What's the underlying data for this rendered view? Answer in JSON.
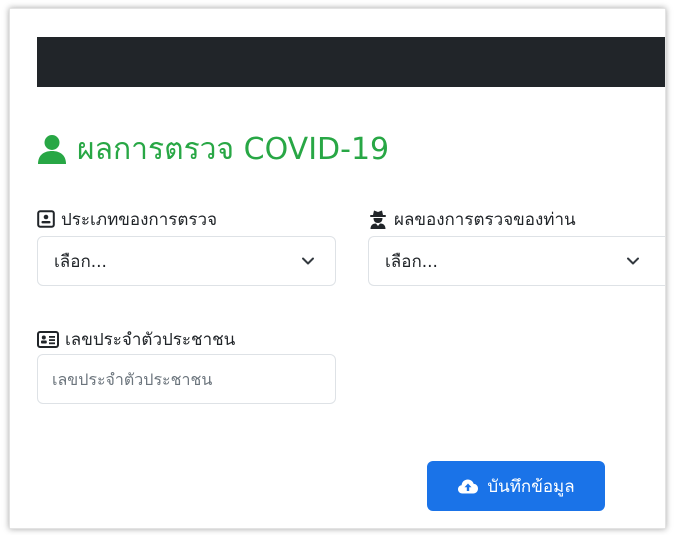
{
  "form": {
    "title": "ผลการตรวจ COVID-19",
    "test_type_label": "ประเภทของการตรวจ",
    "test_type_value": "เลือก...",
    "result_label": "ผลของการตรวจของท่าน",
    "result_value": "เลือก...",
    "id_label": "เลขประจำตัวประชาชน",
    "id_placeholder": "เลขประจำตัวประชาชน",
    "id_value": "",
    "save_button": "บันทึกข้อมูล"
  },
  "icons": {
    "title": "user-icon",
    "test_type": "id-badge-icon",
    "result": "user-secret-icon",
    "id": "id-card-icon",
    "save": "cloud-upload-icon",
    "select": "chevron-down-icon"
  },
  "colors": {
    "title_green": "#28a745",
    "header_dark": "#212529",
    "button_blue": "#1a73e8"
  }
}
